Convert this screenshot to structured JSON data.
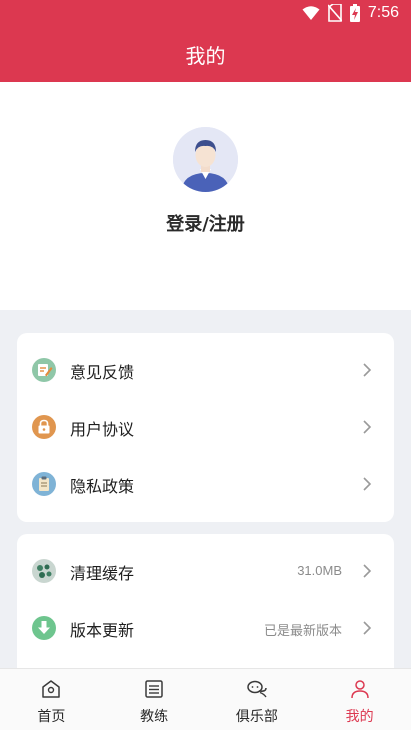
{
  "status_bar": {
    "time": "7:56"
  },
  "header": {
    "title": "我的"
  },
  "profile": {
    "login_label": "登录/注册"
  },
  "menu_group1": [
    {
      "label": "意见反馈",
      "icon": "feedback-icon"
    },
    {
      "label": "用户协议",
      "icon": "lock-icon"
    },
    {
      "label": "隐私政策",
      "icon": "clipboard-icon"
    }
  ],
  "menu_group2": [
    {
      "label": "清理缓存",
      "value": "31.0MB",
      "icon": "clean-icon"
    },
    {
      "label": "版本更新",
      "value": "已是最新版本",
      "icon": "download-icon"
    }
  ],
  "tabs": [
    {
      "label": "首页",
      "icon": "home-icon"
    },
    {
      "label": "教练",
      "icon": "list-icon"
    },
    {
      "label": "俱乐部",
      "icon": "chat-icon"
    },
    {
      "label": "我的",
      "icon": "user-icon",
      "active": true
    }
  ],
  "colors": {
    "accent": "#dc3850",
    "background": "#eef0f4"
  }
}
